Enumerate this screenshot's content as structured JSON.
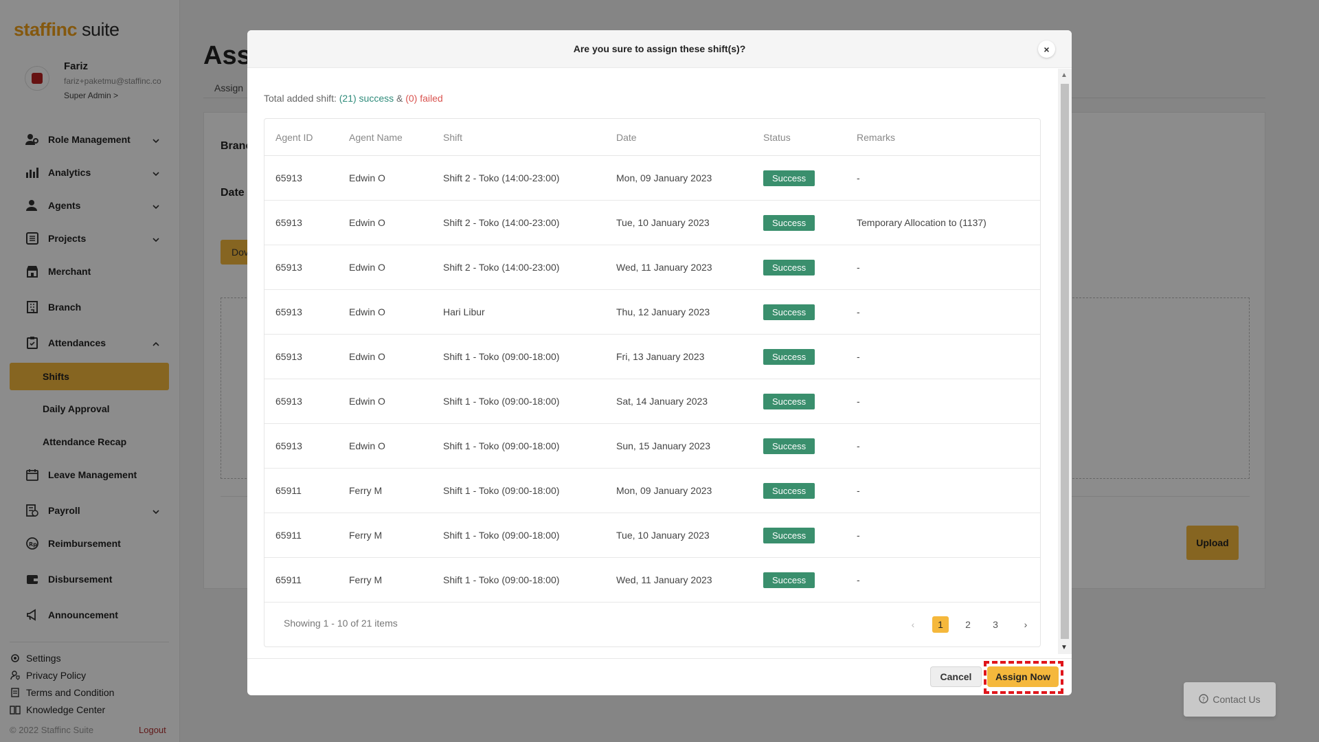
{
  "brand": {
    "logo_main": "staffinc",
    "logo_suffix": " suite"
  },
  "profile": {
    "name": "Fariz",
    "email": "fariz+paketmu@staffinc.co",
    "role": "Super Admin >"
  },
  "sidebar": {
    "items": [
      {
        "label": "Role Management",
        "icon": "role-icon"
      },
      {
        "label": "Analytics",
        "icon": "analytics-icon"
      },
      {
        "label": "Agents",
        "icon": "agents-icon"
      },
      {
        "label": "Projects",
        "icon": "projects-icon"
      },
      {
        "label": "Merchant",
        "icon": "merchant-icon"
      },
      {
        "label": "Branch",
        "icon": "branch-icon"
      },
      {
        "label": "Attendances",
        "icon": "attendances-icon"
      },
      {
        "label": "Leave Management",
        "icon": "calendar-icon"
      },
      {
        "label": "Payroll",
        "icon": "payroll-icon"
      },
      {
        "label": "Reimbursement",
        "icon": "reimbursement-icon"
      },
      {
        "label": "Disbursement",
        "icon": "wallet-icon"
      },
      {
        "label": "Announcement",
        "icon": "megaphone-icon"
      }
    ],
    "sub_items": [
      "Shifts",
      "Daily Approval",
      "Attendance Recap"
    ],
    "footer": [
      "Settings",
      "Privacy Policy",
      "Terms and Condition",
      "Knowledge Center"
    ],
    "copyright": "© 2022 Staffinc Suite",
    "logout": "Logout"
  },
  "background": {
    "title": "Ass",
    "tab": "Assign",
    "branch_label": "Branc",
    "date_label": "Date",
    "download_label": "Dov",
    "upload_label": "Upload",
    "contact_label": "Contact Us"
  },
  "modal": {
    "title": "Are you sure to assign these shift(s)?",
    "close": "×",
    "summary": {
      "prefix": "Total added shift: ",
      "success": "(21) success",
      "amp": " & ",
      "failed": "(0) failed"
    },
    "columns": [
      "Agent ID",
      "Agent Name",
      "Shift",
      "Date",
      "Status",
      "Remarks"
    ],
    "rows": [
      {
        "id": "65913",
        "name": "Edwin O",
        "shift": "Shift 2 - Toko (14:00-23:00)",
        "date": "Mon, 09 January 2023",
        "status": "Success",
        "remarks": "-"
      },
      {
        "id": "65913",
        "name": "Edwin O",
        "shift": "Shift 2 - Toko (14:00-23:00)",
        "date": "Tue, 10 January 2023",
        "status": "Success",
        "remarks": "Temporary Allocation to (1137)"
      },
      {
        "id": "65913",
        "name": "Edwin O",
        "shift": "Shift 2 - Toko (14:00-23:00)",
        "date": "Wed, 11 January 2023",
        "status": "Success",
        "remarks": "-"
      },
      {
        "id": "65913",
        "name": "Edwin O",
        "shift": "Hari Libur",
        "date": "Thu, 12 January 2023",
        "status": "Success",
        "remarks": "-"
      },
      {
        "id": "65913",
        "name": "Edwin O",
        "shift": "Shift 1 - Toko (09:00-18:00)",
        "date": "Fri, 13 January 2023",
        "status": "Success",
        "remarks": "-"
      },
      {
        "id": "65913",
        "name": "Edwin O",
        "shift": "Shift 1 - Toko (09:00-18:00)",
        "date": "Sat, 14 January 2023",
        "status": "Success",
        "remarks": "-"
      },
      {
        "id": "65913",
        "name": "Edwin O",
        "shift": "Shift 1 - Toko (09:00-18:00)",
        "date": "Sun, 15 January 2023",
        "status": "Success",
        "remarks": "-"
      },
      {
        "id": "65911",
        "name": "Ferry M",
        "shift": "Shift 1 - Toko (09:00-18:00)",
        "date": "Mon, 09 January 2023",
        "status": "Success",
        "remarks": "-"
      },
      {
        "id": "65911",
        "name": "Ferry M",
        "shift": "Shift 1 - Toko (09:00-18:00)",
        "date": "Tue, 10 January 2023",
        "status": "Success",
        "remarks": "-"
      },
      {
        "id": "65911",
        "name": "Ferry M",
        "shift": "Shift 1 - Toko (09:00-18:00)",
        "date": "Wed, 11 January 2023",
        "status": "Success",
        "remarks": "-"
      }
    ],
    "pagination": {
      "info": "Showing 1 - 10 of 21 items",
      "pages": [
        "1",
        "2",
        "3"
      ],
      "current": "1",
      "prev": "‹",
      "next": "›"
    },
    "cancel_label": "Cancel",
    "assign_label": "Assign Now"
  },
  "colors": {
    "accent": "#f5b83c",
    "success_badge": "#3a8f6d",
    "success_text": "#2e8b7a",
    "failed_text": "#d9534f",
    "highlight": "#e0151b"
  }
}
